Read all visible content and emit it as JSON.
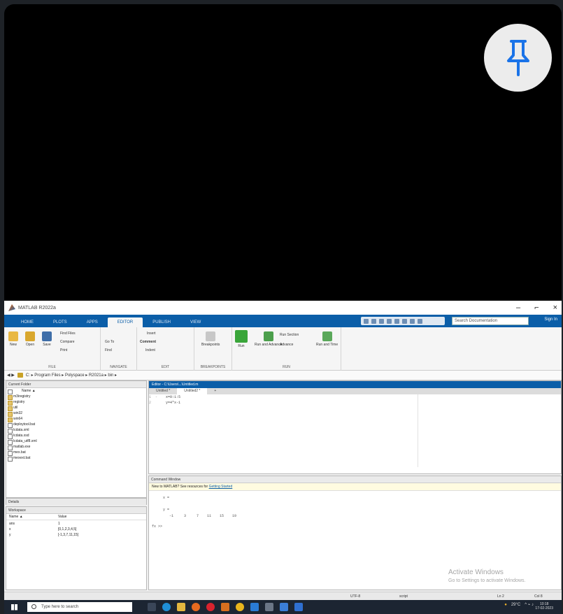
{
  "pin": {
    "icon": "pushpin-icon"
  },
  "window": {
    "title": "MATLAB R2022a",
    "controls": {
      "minimize": "–",
      "maximize": "⌐",
      "close": "×"
    }
  },
  "ribbon_tabs": [
    "HOME",
    "PLOTS",
    "APPS",
    "EDITOR",
    "PUBLISH",
    "VIEW"
  ],
  "active_tab": "EDITOR",
  "search_placeholder": "Search Documentation",
  "sign_in": "Sign In",
  "ribbon": {
    "file": {
      "new": "New",
      "open": "Open",
      "save": "Save",
      "find_files": "Find Files",
      "compare": "Compare",
      "print": "Print",
      "label": "FILE"
    },
    "navigate": {
      "go_to": "Go To",
      "find": "Find",
      "label": "NAVIGATE"
    },
    "edit": {
      "insert": "Insert",
      "comment": "Comment",
      "indent": "Indent",
      "label": "EDIT"
    },
    "breakpoints": {
      "btn": "Breakpoints",
      "label": "BREAKPOINTS"
    },
    "run": {
      "run": "Run",
      "run_advance": "Run and Advance",
      "run_section": "Run Section",
      "advance": "Advance",
      "run_time": "Run and Time",
      "label": "RUN"
    }
  },
  "address": {
    "path": "C: ▸ Program Files ▸ Polyspace ▸ R2021a ▸ bin ▸"
  },
  "current_folder": {
    "header": "Current Folder",
    "name_col": "Name ▲",
    "files": [
      {
        "name": "m3iregistry",
        "folder": true
      },
      {
        "name": "registry",
        "folder": true
      },
      {
        "name": "util",
        "folder": true
      },
      {
        "name": "win32",
        "folder": true
      },
      {
        "name": "win64",
        "folder": true
      },
      {
        "name": "deploytool.bat",
        "folder": false
      },
      {
        "name": "lcdata.xml",
        "folder": false
      },
      {
        "name": "lcdata.xsd",
        "folder": false
      },
      {
        "name": "lcdata_utf8.xml",
        "folder": false
      },
      {
        "name": "matlab.exe",
        "folder": false
      },
      {
        "name": "mex.bat",
        "folder": false
      },
      {
        "name": "mexext.bat",
        "folder": false
      }
    ],
    "details": "Details"
  },
  "workspace": {
    "header": "Workspace",
    "cols": [
      "Name ▲",
      "Value"
    ],
    "rows": [
      {
        "name": "ans",
        "value": "1"
      },
      {
        "name": "x",
        "value": "[0,1,2,3,4,5]"
      },
      {
        "name": "y",
        "value": "[-1,3,7,11,15]"
      }
    ]
  },
  "editor": {
    "title": "Editor - C:\\Users\\...\\Untitled.m",
    "tabs": [
      "Untitled *",
      "Untitled2 *"
    ],
    "lines": [
      "x=0:1:5",
      "y=4*x-1"
    ]
  },
  "command_window": {
    "header": "Command Window",
    "notice_prefix": "New to MATLAB? See resources for ",
    "notice_link": "Getting Started",
    "out1": "  x =",
    "out2": "  y =",
    "values": "     -1     3     7    11    15    19",
    "prompt": "fx >>"
  },
  "watermark": {
    "line1": "Activate Windows",
    "line2": "Go to Settings to activate Windows."
  },
  "status": {
    "left": "UTF-8",
    "mid": "script",
    "ln": "Ln  2",
    "col": "Col  8"
  },
  "taskbar": {
    "search": "Type here to search",
    "weather": "29°C",
    "time": "10:18",
    "date": "17-02-2023"
  }
}
